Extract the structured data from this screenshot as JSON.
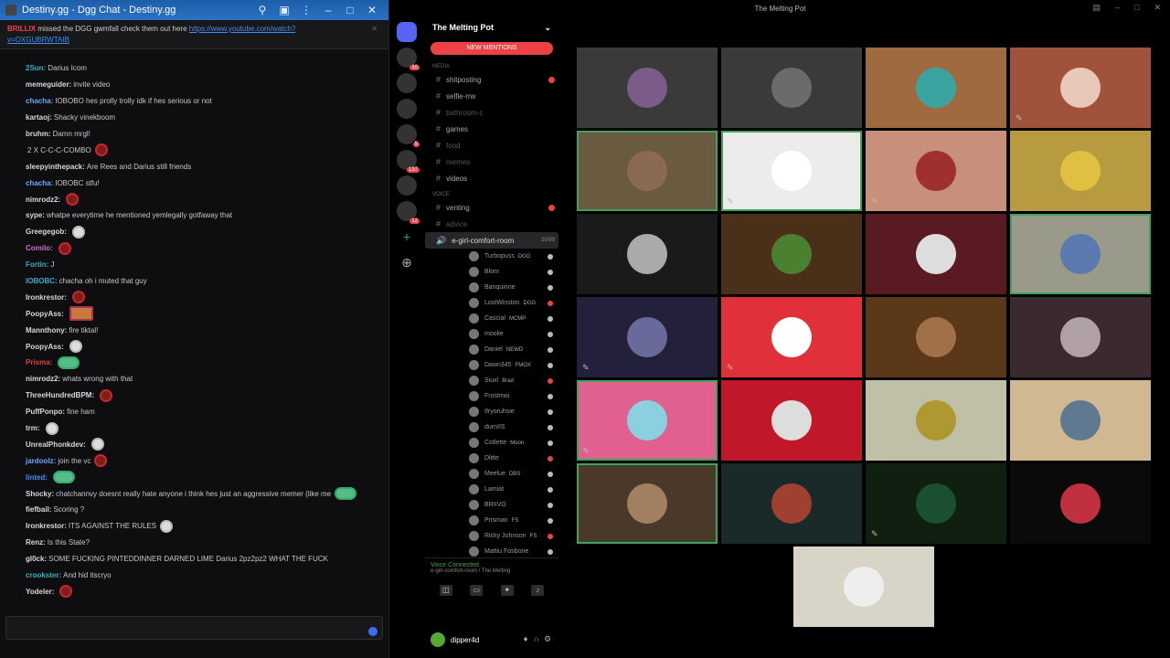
{
  "chat": {
    "title": "Destiny.gg - Dgg Chat - Destiny.gg",
    "window_controls": [
      "pin-icon",
      "grid-icon",
      "more-icon",
      "minimize-icon",
      "maximize-icon",
      "close-icon"
    ],
    "pinned": {
      "user": "BRILLIX",
      "text": "missed the DGG gwmfall check them out here",
      "link": "https://www.youtube.com/watch?",
      "tail": "v=OXGUBRWTAIB"
    },
    "messages": [
      {
        "user": "2Sun:",
        "text": "Darius Icom",
        "color": "#2fb0c0"
      },
      {
        "user": "memeguider:",
        "text": "invite video",
        "color": "#d8d8d8"
      },
      {
        "user": "chacha:",
        "text": "IOBOBO hes prolly trolly idk if hes serious or not",
        "color": "#6ea8ff"
      },
      {
        "user": "kartaoj:",
        "text": "Shacky vinekboom",
        "color": "#d8d8d8"
      },
      {
        "user": "bruhm:",
        "text": "Damn mrgl!",
        "color": "#d8d8d8"
      },
      {
        "user": "",
        "text": "2 X C-C-C-COMBO",
        "color": "#d8d8d8",
        "emote": "red"
      },
      {
        "user": "sleepyinthepack:",
        "text": "Are Rees and Darius still friends",
        "color": "#d8d8d8"
      },
      {
        "user": "chacha:",
        "text": "IOBOBC stfu!",
        "color": "#6ea8ff"
      },
      {
        "user": "nimrodz2:",
        "text": "",
        "color": "#d8d8d8",
        "emote": "red"
      },
      {
        "user": "sype:",
        "text": "whatpe everytime he mentioned yemlegally gotfaway that",
        "color": "#d8d8d8"
      },
      {
        "user": "Greegegob:",
        "text": "",
        "color": "#d8d8d8",
        "emote": "ghost"
      },
      {
        "user": "Comilo:",
        "text": "",
        "color": "#d06bd0",
        "emote": "red"
      },
      {
        "user": "Fortin:",
        "text": "J",
        "color": "#2fb0c0"
      },
      {
        "user": "IOBOBC:",
        "text": "chacha oh i muted that guy",
        "color": "#2fb0c0"
      },
      {
        "user": "Ironkrestor:",
        "text": "",
        "color": "#d8d8d8",
        "emote": "red"
      },
      {
        "user": "PoopyAss:",
        "text": "",
        "color": "#d8d8d8",
        "emote": "sq"
      },
      {
        "user": "Mannthony:",
        "text": "fire tiktal!",
        "color": "#d8d8d8"
      },
      {
        "user": "PoopyAss:",
        "text": "",
        "color": "#d8d8d8",
        "emote": "ghost"
      },
      {
        "user": "Prisma:",
        "text": "",
        "color": "#e04040",
        "emote": "blob"
      },
      {
        "user": "nimrodz2:",
        "text": "whats wrong with that",
        "color": "#d8d8d8"
      },
      {
        "user": "ThreeHundredBPM:",
        "text": "",
        "color": "#d8d8d8",
        "emote": "red"
      },
      {
        "user": "PuffPonpo:",
        "text": "fine ham",
        "color": "#d8d8d8"
      },
      {
        "user": "trm:",
        "text": "",
        "color": "#d8d8d8",
        "emote": "ghost"
      },
      {
        "user": "UnrealPhonkdev:",
        "text": "",
        "color": "#d8d8d8",
        "emote": "ghost"
      },
      {
        "user": "jardoolz:",
        "text": "join the vc",
        "color": "#6ea8ff",
        "emote": "red"
      },
      {
        "user": "linted:",
        "text": "",
        "color": "#3b8ff6",
        "emote": "blob"
      },
      {
        "user": "Shocky:",
        "text": "chatchannvy doesnt really hate anyone i think hes just an aggressive memer (like me",
        "color": "#d8d8d8",
        "emote": "blob"
      },
      {
        "user": "fiefbail:",
        "text": "Scoring ?",
        "color": "#d8d8d8"
      },
      {
        "user": "Ironkrestor:",
        "text": "ITS AGAINST THE RULES",
        "color": "#d8d8d8",
        "emote": "ghost"
      },
      {
        "user": "Renz:",
        "text": "Is this State?",
        "color": "#d8d8d8"
      },
      {
        "user": "gl0ck:",
        "text": "SOME FUCKING PINTEDDINNER DARNED LIME Darius 2pz2pz2 WHAT THE FUCK",
        "color": "#d8d8d8"
      },
      {
        "user": "crookster:",
        "text": "And hid itscryo",
        "color": "#2fb0c0"
      },
      {
        "user": "Yodeler:",
        "text": "",
        "color": "#d8d8d8",
        "emote": "red"
      }
    ],
    "input_placeholder": "",
    "footer_left": "",
    "footer_right": ""
  },
  "discord": {
    "window_title": "The Melting Pot",
    "server_name": "The Melting Pot",
    "new_mentions": "NEW MENTIONS",
    "servers": [
      {
        "icon": "discord-home-icon",
        "badge": ""
      },
      {
        "icon": "server-icon",
        "badge": "10"
      },
      {
        "icon": "server-icon",
        "badge": ""
      },
      {
        "icon": "server-icon",
        "badge": ""
      },
      {
        "icon": "server-icon",
        "badge": "5"
      },
      {
        "icon": "server-icon",
        "badge": "137"
      },
      {
        "icon": "server-icon",
        "badge": ""
      },
      {
        "icon": "server-icon",
        "badge": "12"
      }
    ],
    "categories": [
      "media",
      "voice"
    ],
    "channels_text": [
      {
        "name": "shitposting",
        "dot": true,
        "dim": false
      },
      {
        "name": "selfie-rrw",
        "dot": false,
        "dim": false
      },
      {
        "name": "bathroom-c",
        "dot": false,
        "dim": true
      },
      {
        "name": "games",
        "dot": false,
        "dim": false
      },
      {
        "name": "food",
        "dot": false,
        "dim": true
      },
      {
        "name": "memes",
        "dot": false,
        "dim": true
      },
      {
        "name": "videos",
        "dot": false,
        "dim": false
      }
    ],
    "channels_voice_text": [
      {
        "name": "venting",
        "dot": true,
        "dim": false
      },
      {
        "name": "advice",
        "dot": false,
        "dim": true
      }
    ],
    "voice_channel": {
      "name": "e-girl-comfort-room",
      "limit": "20/99"
    },
    "voice_users": [
      {
        "name": "Turbopuss",
        "tag": "DGG"
      },
      {
        "name": "Blom",
        "tag": ""
      },
      {
        "name": "Banquinne",
        "tag": ""
      },
      {
        "name": "LostWinston",
        "tag": "DGG"
      },
      {
        "name": "Cascial",
        "tag": "MCMP"
      },
      {
        "name": "moolie",
        "tag": ""
      },
      {
        "name": "Daniel",
        "tag": "NEWD"
      },
      {
        "name": "Dawn345",
        "tag": "FMOX"
      },
      {
        "name": "Siuxl",
        "tag": "Brad"
      },
      {
        "name": "Frostmoi",
        "tag": ""
      },
      {
        "name": "Ifryoruhsie",
        "tag": ""
      },
      {
        "name": "durnIIS",
        "tag": ""
      },
      {
        "name": "Cotlette",
        "tag": "Moon"
      },
      {
        "name": "Dlitte",
        "tag": ""
      },
      {
        "name": "Meelue",
        "tag": "DBS"
      },
      {
        "name": "Lamiat",
        "tag": ""
      },
      {
        "name": "BRIIVO",
        "tag": ""
      },
      {
        "name": "Prisman",
        "tag": "FS"
      },
      {
        "name": "Ricky Johnson",
        "tag": "FS"
      },
      {
        "name": "Mattiu Fosbone",
        "tag": ""
      }
    ],
    "voice_status": {
      "label": "Voice Connected",
      "sub": "e-girl-comfort-room / The Melting"
    },
    "user": {
      "name": "dipper4d",
      "status": ""
    },
    "tiles": [
      {
        "bg": "#3a3a3a",
        "avatar": "#7a5b8a",
        "muted": false,
        "speaking": false
      },
      {
        "bg": "#3a3a3a",
        "avatar": "#6b6b6b",
        "muted": false,
        "speaking": false
      },
      {
        "bg": "#a06a40",
        "avatar": "#3aa4a0",
        "muted": false,
        "speaking": false
      },
      {
        "bg": "#a0533a",
        "avatar": "#e8c8b8",
        "muted": true,
        "speaking": false
      },
      {
        "bg": "#6a5a40",
        "avatar": "#8a6a50",
        "muted": false,
        "speaking": true
      },
      {
        "bg": "#ececea",
        "avatar": "#ffffff",
        "muted": true,
        "speaking": true
      },
      {
        "bg": "#c8907a",
        "avatar": "#a03030",
        "muted": true,
        "speaking": false
      },
      {
        "bg": "#b89a40",
        "avatar": "#e0c040",
        "muted": false,
        "speaking": false
      },
      {
        "bg": "#1a1a1a",
        "avatar": "#aaaaaa",
        "muted": false,
        "speaking": false
      },
      {
        "bg": "#4a3018",
        "avatar": "#4a8030",
        "muted": false,
        "speaking": false
      },
      {
        "bg": "#5a1a22",
        "avatar": "#dddddd",
        "muted": false,
        "speaking": false
      },
      {
        "bg": "#9a9a8a",
        "avatar": "#5a7ab0",
        "muted": false,
        "speaking": true
      },
      {
        "bg": "#22203a",
        "avatar": "#6a6a9a",
        "muted": true,
        "speaking": false
      },
      {
        "bg": "#e0303a",
        "avatar": "#ffffff",
        "muted": true,
        "speaking": false
      },
      {
        "bg": "#5a3818",
        "avatar": "#a0704a",
        "muted": false,
        "speaking": false
      },
      {
        "bg": "#3a2a30",
        "avatar": "#b0a0a8",
        "muted": false,
        "speaking": false
      },
      {
        "bg": "#e06090",
        "avatar": "#8ad0e0",
        "muted": true,
        "speaking": true
      },
      {
        "bg": "#c01828",
        "avatar": "#dddddd",
        "muted": false,
        "speaking": false
      },
      {
        "bg": "#c0c0a8",
        "avatar": "#b09830",
        "muted": false,
        "speaking": false
      },
      {
        "bg": "#d0b890",
        "avatar": "#607890",
        "muted": true,
        "speaking": false
      },
      {
        "bg": "#4a3828",
        "avatar": "#a08060",
        "muted": false,
        "speaking": true
      },
      {
        "bg": "#1a2a28",
        "avatar": "#a04030",
        "muted": false,
        "speaking": false
      },
      {
        "bg": "#102010",
        "avatar": "#1a5030",
        "muted": true,
        "speaking": false
      },
      {
        "bg": "#0a0a0a",
        "avatar": "#c03040",
        "muted": false,
        "speaking": false
      },
      {
        "bg": "#d8d4c8",
        "avatar": "#eeeeee",
        "muted": false,
        "speaking": false
      }
    ]
  }
}
